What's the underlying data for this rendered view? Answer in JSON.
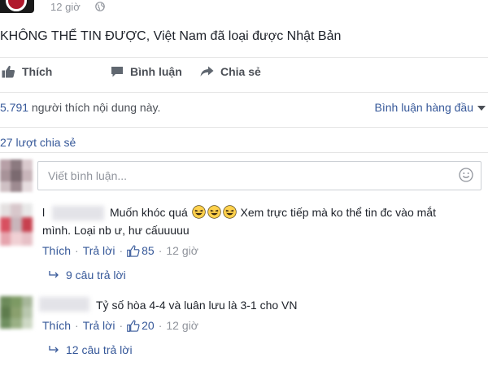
{
  "post": {
    "time": "12 giờ",
    "dot": "·",
    "text": "KHÔNG THỂ TIN ĐƯỢC, Việt Nam đã loại được Nhật Bản"
  },
  "actions": {
    "like_label": "Thích",
    "comment_label": "Bình luận",
    "share_label": "Chia sẻ"
  },
  "likes": {
    "count": "5.791",
    "text": " người thích nội dung này."
  },
  "sort": {
    "selected": "Bình luận hàng đầu"
  },
  "shares": {
    "text": "27 lượt chia sẻ"
  },
  "comment_box": {
    "placeholder": "Viết bình luận..."
  },
  "comments": [
    {
      "name_prefix": "l",
      "text_a": "Muốn khóc quá ",
      "text_b": " Xem trực tiếp mà ko thể tin đc vào mắt",
      "text_line2": "mình. Loại nb ư, hư cấuuuuu",
      "like_label": "Thích",
      "reply_label": "Trả lời",
      "likes": "85",
      "dot": "·",
      "time": "12 giờ",
      "replies": "9 câu trả lời",
      "avatar_colors": [
        "#e4e0e0",
        "#d8c7cb",
        "#e8e8e8",
        "#d85060",
        "#c9b5bb",
        "#c7404f",
        "#e6a4ad",
        "#f0d0d4",
        "#e7c0c6"
      ]
    },
    {
      "text": "Tỷ số hòa 4-4 và luân lưu là 3-1 cho VN",
      "like_label": "Thích",
      "reply_label": "Trả lời",
      "likes": "20",
      "dot": "·",
      "time": "12 giờ",
      "replies": "12 câu trả lời",
      "avatar_colors": [
        "#6c8a5a",
        "#7d9a64",
        "#a7b79a",
        "#5e7c4d",
        "#8aa06e",
        "#b9c7ae",
        "#6f8f60",
        "#9ab085",
        "#cdd8c4"
      ]
    }
  ],
  "my_avatar_colors": [
    "#b7a0a7",
    "#8c7a80",
    "#d9c9cd",
    "#a89399",
    "#7b6a70",
    "#c8b5ba",
    "#cfc0c4",
    "#9e8b91",
    "#e6dcdf"
  ],
  "icons": {
    "globe": "globe-icon",
    "like": "thumbs-up-icon",
    "comment": "speech-bubble-icon",
    "share": "share-arrow-icon",
    "emoji": "smiley-icon",
    "reply_arrow": "reply-arrow-icon",
    "laugh": "laughing-face-icon"
  },
  "colors": {
    "link": "#365899",
    "muted": "#90949c",
    "action": "#4b4f56"
  }
}
